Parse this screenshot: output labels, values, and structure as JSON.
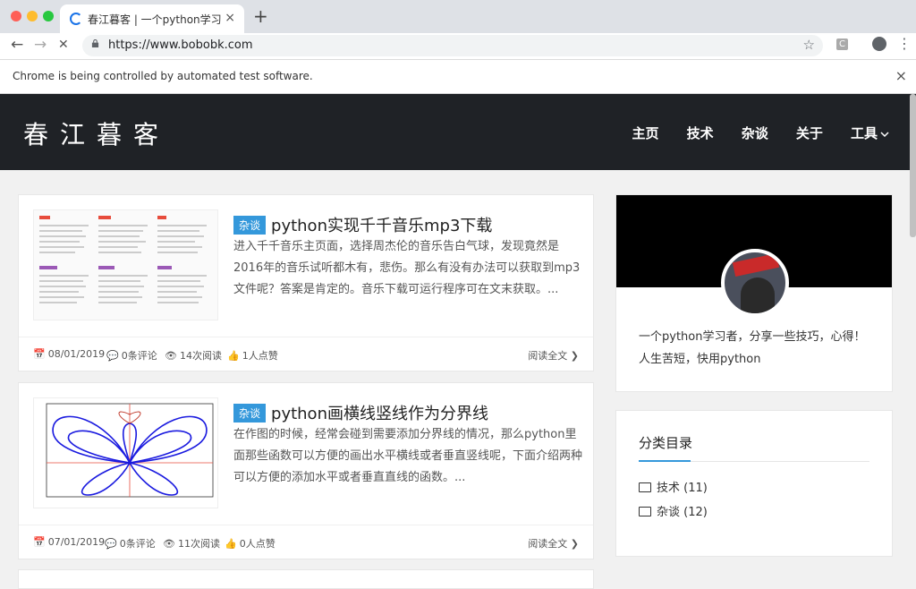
{
  "browser": {
    "tab_title": "春江暮客 | 一个python学习者的",
    "tab_close": "×",
    "new_tab": "+",
    "back": "←",
    "forward": "→",
    "stop": "✕",
    "url": "https://www.bobobk.com",
    "bookmark": "☆",
    "extension_label": "C",
    "menu": "⋮",
    "infobar_text": "Chrome is being controlled by automated test software.",
    "infobar_close": "×"
  },
  "site": {
    "logo": "春江暮客",
    "nav": [
      "主页",
      "技术",
      "杂谈",
      "关于",
      "工具"
    ]
  },
  "posts": [
    {
      "category": "杂谈",
      "title": "python实现千千音乐mp3下载",
      "excerpt": "进入千千音乐主页面，选择周杰伦的音乐告白气球，发现竟然是2016年的音乐试听都木有，悲伤。那么有没有办法可以获取到mp3文件呢？答案是肯定的。音乐下载可运行程序可在文末获取。...",
      "date": "08/01/2019",
      "comments": "0条评论",
      "views": "14次阅读",
      "likes": "1人点赞",
      "read_more": "阅读全文"
    },
    {
      "category": "杂谈",
      "title": "python画横线竖线作为分界线",
      "excerpt": "在作图的时候，经常会碰到需要添加分界线的情况，那么python里面那些函数可以方便的画出水平横线或者垂直竖线呢，下面介绍两种可以方便的添加水平或者垂直直线的函数。...",
      "date": "07/01/2019",
      "comments": "0条评论",
      "views": "11次阅读",
      "likes": "0人点赞",
      "read_more": "阅读全文"
    }
  ],
  "sidebar": {
    "bio": "一个python学习者，分享一些技巧，心得！ 人生苦短，快用python",
    "categories_heading": "分类目录",
    "categories": [
      {
        "label": "技术 (11)"
      },
      {
        "label": "杂谈 (12)"
      }
    ]
  },
  "icons": {
    "calendar": "📅",
    "comment": "💬",
    "eye": "👁",
    "thumb": "👍",
    "arrow": "❯"
  },
  "colors": {
    "header_bg": "#1f2226",
    "accent": "#3498db"
  }
}
